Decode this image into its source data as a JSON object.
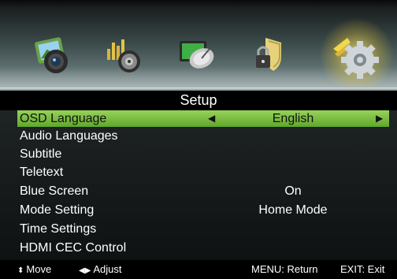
{
  "menu_title": "Setup",
  "tabs": [
    {
      "icon": "picture-icon"
    },
    {
      "icon": "sound-icon"
    },
    {
      "icon": "channel-icon"
    },
    {
      "icon": "lock-icon"
    },
    {
      "icon": "setup-gear-icon",
      "selected": true
    }
  ],
  "items": [
    {
      "label": "OSD Language",
      "value": "English",
      "selected": true
    },
    {
      "label": "Audio Languages",
      "value": ""
    },
    {
      "label": "Subtitle",
      "value": ""
    },
    {
      "label": "Teletext",
      "value": ""
    },
    {
      "label": "Blue Screen",
      "value": "On"
    },
    {
      "label": "Mode Setting",
      "value": "Home Mode"
    },
    {
      "label": "Time Settings",
      "value": ""
    },
    {
      "label": "HDMI CEC Control",
      "value": ""
    }
  ],
  "footer": {
    "move": "Move",
    "adjust": "Adjust",
    "menu": "MENU: Return",
    "exit": "EXIT: Exit"
  },
  "colors": {
    "highlight": "#7bbf41",
    "background": "#000000",
    "text": "#ffffff"
  }
}
